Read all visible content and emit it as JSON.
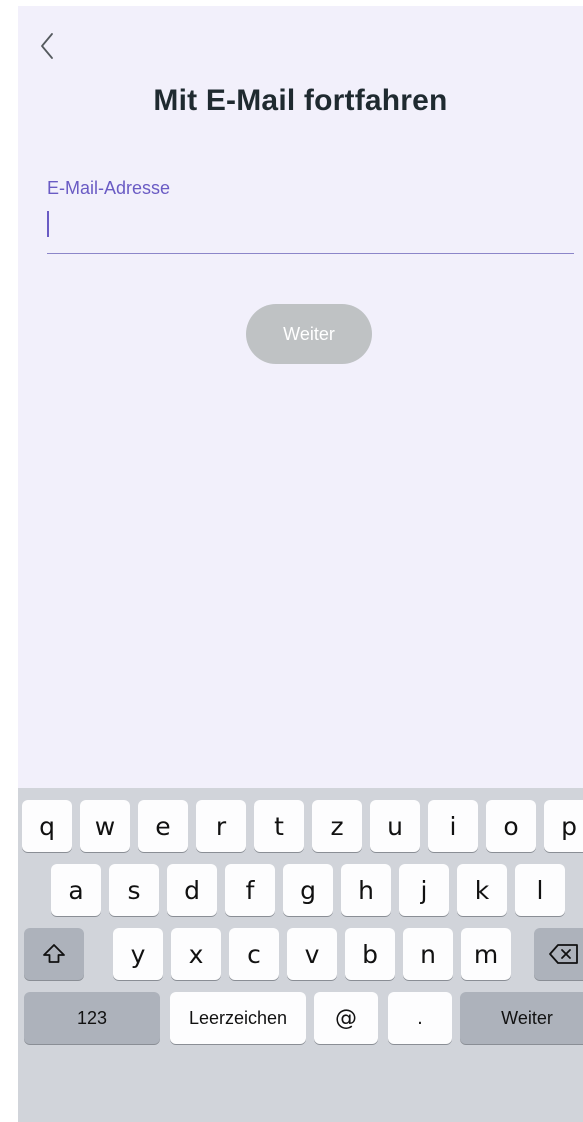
{
  "header": {
    "back_icon": "chevron-left-icon",
    "title": "Mit E-Mail fortfahren"
  },
  "email": {
    "label": "E-Mail-Adresse",
    "value": "",
    "placeholder": ""
  },
  "continue_button": {
    "label": "Weiter",
    "state": "disabled"
  },
  "keyboard": {
    "row1": [
      "q",
      "w",
      "e",
      "r",
      "t",
      "z",
      "u",
      "i",
      "o",
      "p"
    ],
    "row2": [
      "a",
      "s",
      "d",
      "f",
      "g",
      "h",
      "j",
      "k",
      "l"
    ],
    "row3": [
      "y",
      "x",
      "c",
      "v",
      "b",
      "n",
      "m"
    ],
    "shift_icon": "shift-icon",
    "delete_icon": "backspace-icon",
    "numbers_label": "123",
    "space_label": "Leerzeichen",
    "at_label": "@",
    "dot_label": ".",
    "return_label": "Weiter"
  },
  "colors": {
    "background": "#f2f0fb",
    "accent": "#6a5bc4",
    "title": "#1f2a30",
    "button_disabled": "#bfc2c4",
    "keyboard_bg": "#d1d4da"
  }
}
